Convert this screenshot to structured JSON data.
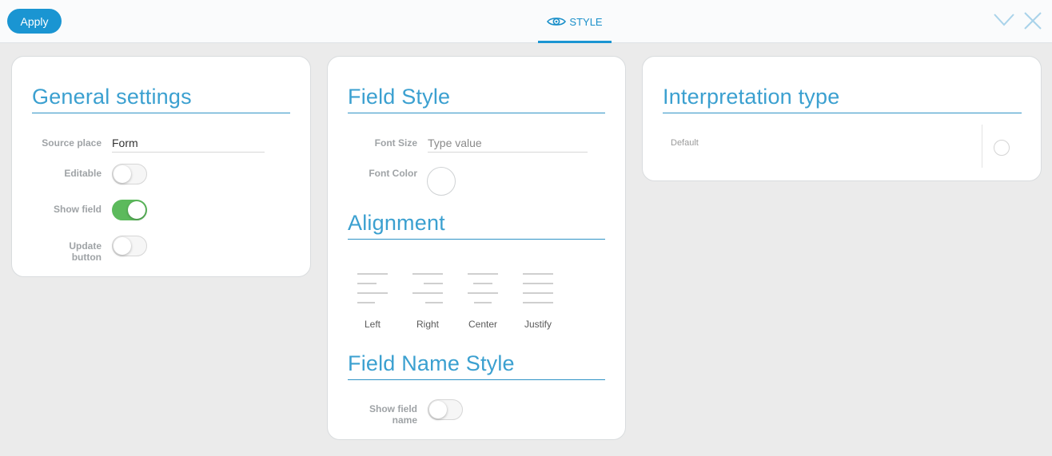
{
  "toolbar": {
    "apply_label": "Apply",
    "tab_label": "STYLE",
    "tab_icon": "eye-icon",
    "collapse_icon": "chevron-down-icon",
    "close_icon": "close-icon"
  },
  "general": {
    "title": "General settings",
    "source_place_label": "Source place",
    "source_place_value": "Form",
    "editable_label": "Editable",
    "editable_on": false,
    "show_field_label": "Show field",
    "show_field_on": true,
    "update_label_line1": "Update",
    "update_label_line2": "button",
    "update_on": false
  },
  "field_style": {
    "title": "Field Style",
    "font_size_label": "Font Size",
    "font_size_placeholder": "Type value",
    "font_color_label": "Font Color",
    "alignment_title": "Alignment",
    "alignment_options": [
      "Left",
      "Right",
      "Center",
      "Justify"
    ],
    "name_style_title": "Field Name Style",
    "show_name_line1": "Show field",
    "show_name_line2": "name",
    "show_name_on": false
  },
  "interpretation": {
    "title": "Interpretation type",
    "option_label": "Default"
  },
  "colors": {
    "accent": "#1a95d2",
    "toggle_on": "#5cba5c",
    "background": "#ebebeb"
  }
}
